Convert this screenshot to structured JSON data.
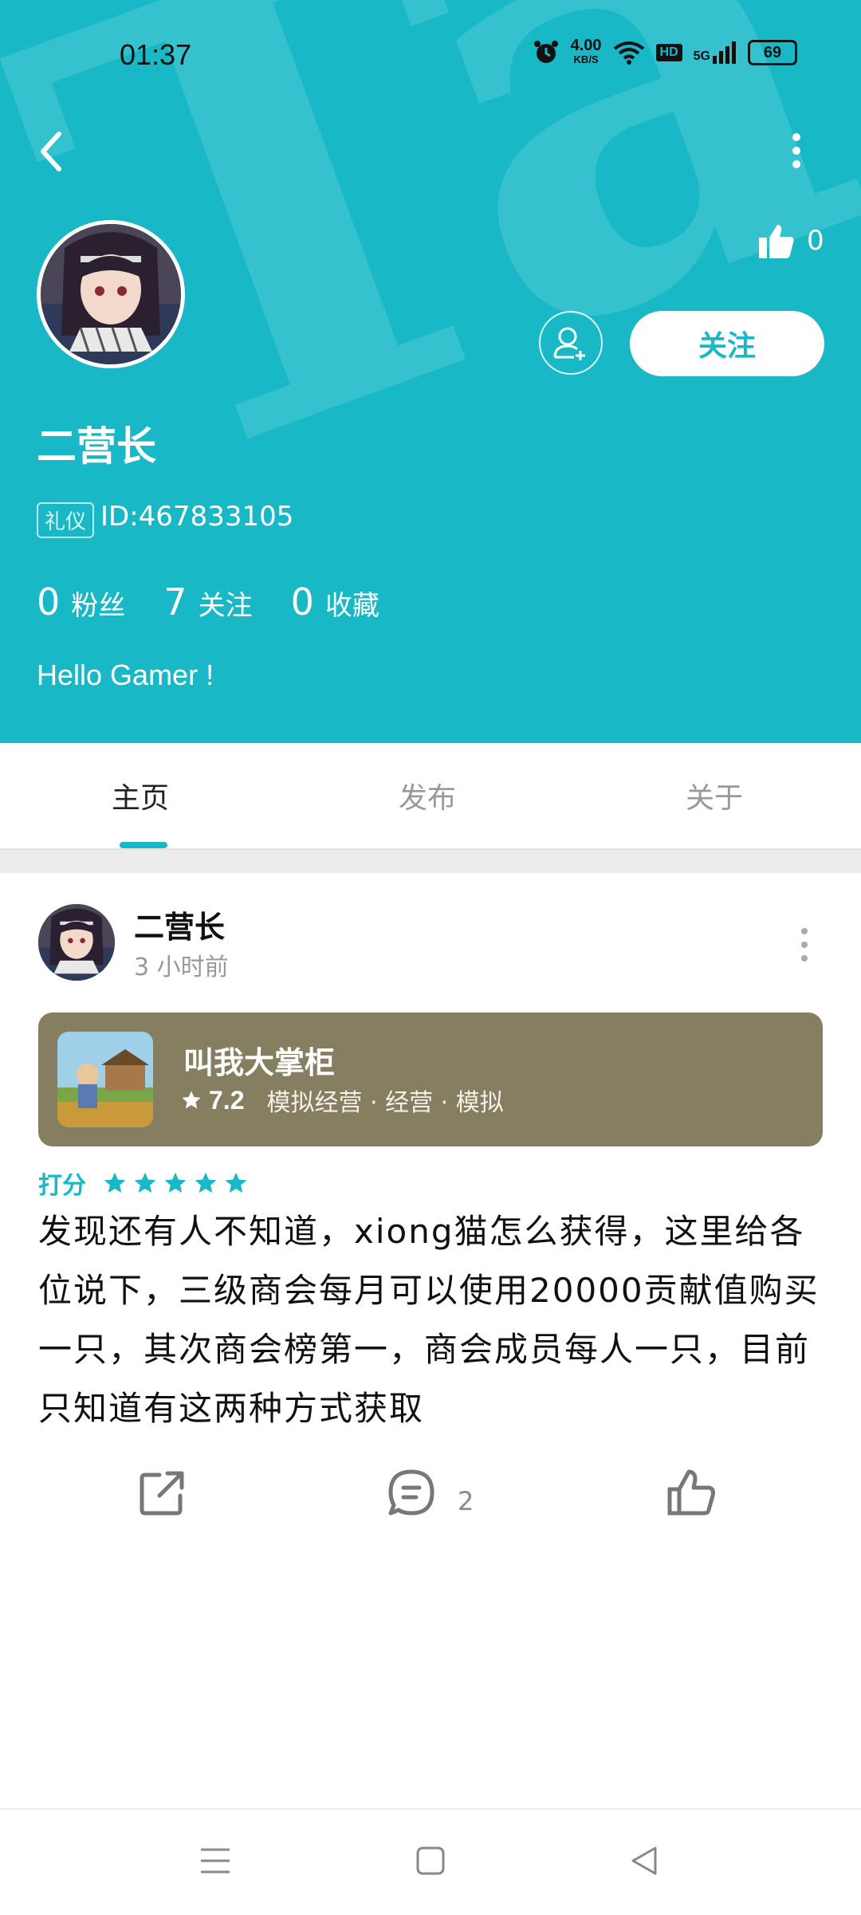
{
  "status_bar": {
    "time": "01:37",
    "speed_value": "4.00",
    "speed_unit": "KB/S",
    "hd_label": "HD",
    "network": "5G",
    "battery": "69"
  },
  "header": {
    "watermark": "TapTap",
    "username": "二营长",
    "role_tag": "礼仪",
    "user_id": "ID:467833105",
    "likes_count": "0",
    "follow_label": "关注",
    "stats": [
      {
        "num": "0",
        "label": "粉丝"
      },
      {
        "num": "7",
        "label": "关注"
      },
      {
        "num": "0",
        "label": "收藏"
      }
    ],
    "bio": "Hello Gamer !"
  },
  "tabs": [
    {
      "label": "主页",
      "active": true
    },
    {
      "label": "发布",
      "active": false
    },
    {
      "label": "关于",
      "active": false
    }
  ],
  "post": {
    "author": "二营长",
    "time": "3 小时前",
    "game": {
      "name": "叫我大掌柜",
      "score": "7.2",
      "tags": "模拟经营 · 经营 · 模拟"
    },
    "rating_label": "打分",
    "rating_stars": 5,
    "body": "发现还有人不知道，xiong猫怎么获得，这里给各位说下，三级商会每月可以使用20000贡献值购买一只，其次商会榜第一，商会成员每人一只，目前只知道有这两种方式获取",
    "comment_count": "2"
  },
  "colors": {
    "accent": "#19b8c7",
    "game_card": "#857e60"
  },
  "icons": [
    "back-icon",
    "more-icon",
    "thumbs-up-icon",
    "add-friend-icon",
    "share-icon",
    "comment-icon",
    "like-icon",
    "menu-icon",
    "home-icon",
    "back-triangle-icon"
  ]
}
